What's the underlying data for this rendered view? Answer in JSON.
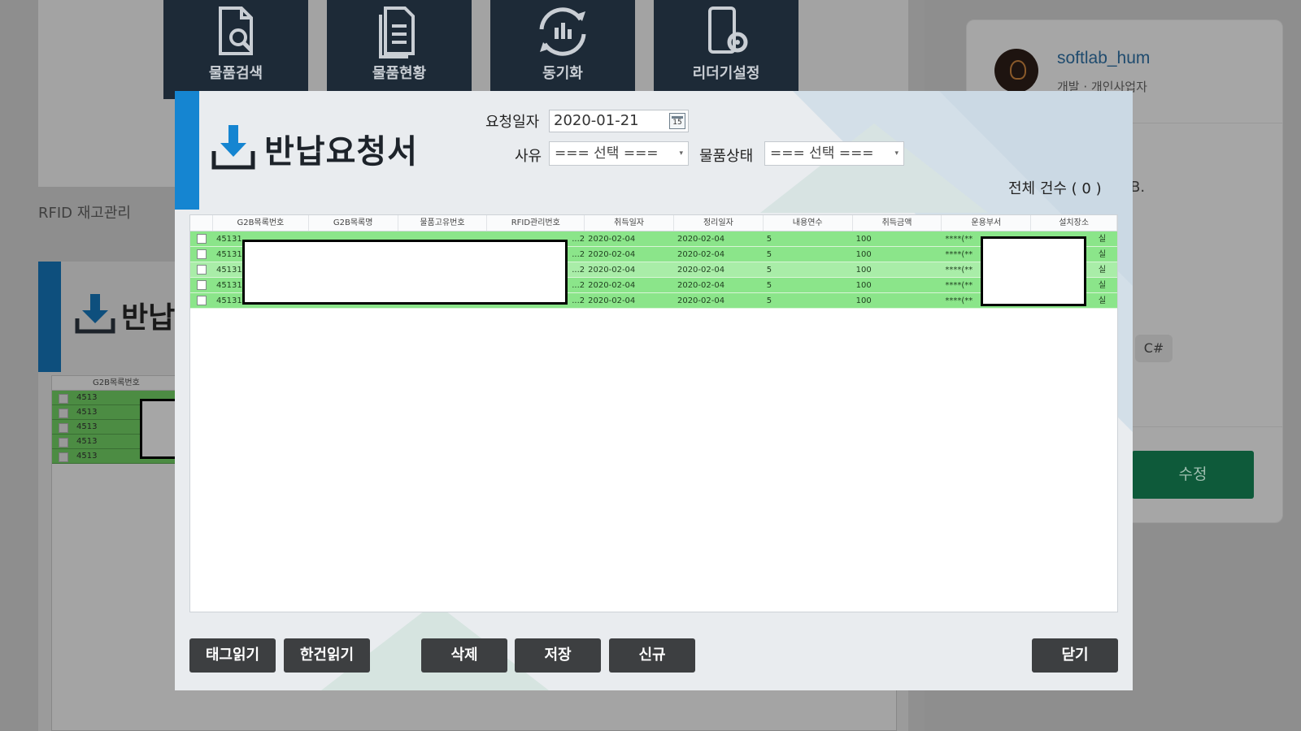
{
  "menu_tiles": [
    {
      "label": "물품검색",
      "icon": "document-search-icon"
    },
    {
      "label": "물품현황",
      "icon": "document-list-icon"
    },
    {
      "label": "동기화",
      "icon": "sync-chart-icon"
    },
    {
      "label": "리더기설정",
      "icon": "device-settings-icon"
    }
  ],
  "background": {
    "rfid_label": "RFID 재고관리",
    "panel_title": "반납",
    "grid_header_first": "G2B목록번호",
    "grid_rows": [
      "4513",
      "4513",
      "4513",
      "4513",
      "4513"
    ],
    "right_fragment": "B.",
    "tag_chip": "C#",
    "edit_button": "수정",
    "profile": {
      "name": "softlab_hum",
      "subtitle": "개발 · 개인사업자"
    }
  },
  "dialog": {
    "title": "반납요청서",
    "request_date_label": "요청일자",
    "request_date_value": "2020-01-21",
    "calendar_icon_text": "15",
    "reason_label": "사유",
    "reason_value": "=== 선택 ===",
    "item_status_label": "물품상태",
    "item_status_value": "=== 선택 ===",
    "total_count": "전체 건수 ( 0 )",
    "grid": {
      "columns": [
        "",
        "G2B목록번호",
        "G2B목록명",
        "물품고유번호",
        "RFID관리번호",
        "취득일자",
        "정리일자",
        "내용연수",
        "취득금액",
        "운용부서",
        "설치장소"
      ],
      "rows": [
        [
          "",
          "45131...",
          "",
          "",
          "...2",
          "2020-02-04",
          "2020-02-04",
          "5",
          "100",
          "****(**",
          "실"
        ],
        [
          "",
          "45131",
          "",
          "",
          "...2",
          "2020-02-04",
          "2020-02-04",
          "5",
          "100",
          "****(**",
          "실"
        ],
        [
          "",
          "45131",
          "",
          "",
          "...2",
          "2020-02-04",
          "2020-02-04",
          "5",
          "100",
          "****(**",
          "실"
        ],
        [
          "",
          "45131",
          "",
          "",
          "...2",
          "2020-02-04",
          "2020-02-04",
          "5",
          "100",
          "****(**",
          "실"
        ],
        [
          "",
          "45131...",
          "",
          "",
          "...2",
          "2020-02-04",
          "2020-02-04",
          "5",
          "100",
          "****(**",
          "실"
        ]
      ]
    },
    "buttons": {
      "tag_read": "태그읽기",
      "single_read": "한건읽기",
      "delete": "삭제",
      "save": "저장",
      "new": "신규",
      "close": "닫기"
    }
  },
  "colors": {
    "accent_blue": "#1585d1",
    "row_green": "#8be58a",
    "button_dark": "#3d3f41",
    "menu_tile": "#1d2a37"
  }
}
